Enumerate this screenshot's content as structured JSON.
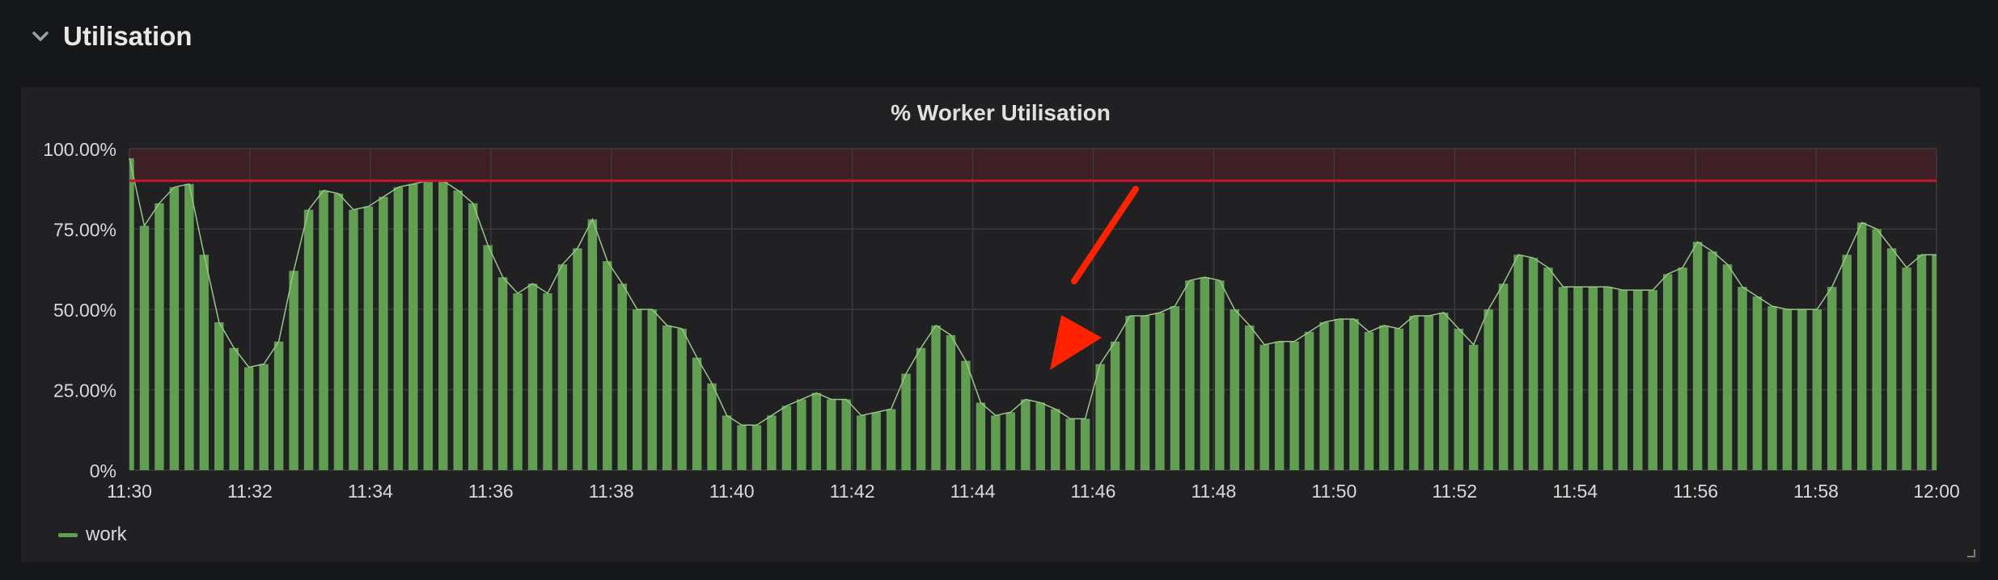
{
  "row": {
    "title": "Utilisation",
    "chevron_icon": "chevron-down-icon"
  },
  "panel": {
    "title": "% Worker Utilisation"
  },
  "colors": {
    "background": "#161719",
    "panel": "#212124",
    "bar": "#629e51",
    "bar_edge": "#9ac48a",
    "threshold_line": "#c4162a",
    "threshold_fill": "rgba(196,22,42,0.18)",
    "arrow": "#ff2200",
    "grid": "#3b3b3d",
    "tick_text": "#d8d9da"
  },
  "chart_data": {
    "type": "bar",
    "title": "% Worker Utilisation",
    "x_tick_labels": [
      "11:30",
      "11:32",
      "11:34",
      "11:36",
      "11:38",
      "11:40",
      "11:42",
      "11:44",
      "11:46",
      "11:48",
      "11:50",
      "11:52",
      "11:54",
      "11:56",
      "11:58",
      "12:00"
    ],
    "y_tick_labels": [
      "0%",
      "25.00%",
      "50.00%",
      "75.00%",
      "100.00%"
    ],
    "y_ticks": [
      0,
      25,
      50,
      75,
      100
    ],
    "ylim": [
      0,
      100
    ],
    "threshold": 90,
    "threshold_region": [
      90,
      100
    ],
    "grid": true,
    "legend_position": "bottom-left",
    "sample_interval_seconds": 10,
    "series": [
      {
        "name": "work",
        "values": [
          97,
          76,
          83,
          88,
          89,
          67,
          46,
          38,
          32,
          33,
          40,
          62,
          81,
          87,
          86,
          81,
          82,
          85,
          88,
          89,
          90,
          90,
          87,
          83,
          70,
          60,
          55,
          58,
          55,
          64,
          69,
          78,
          65,
          58,
          50,
          50,
          45,
          44,
          35,
          27,
          17,
          14,
          14,
          17,
          20,
          22,
          24,
          22,
          22,
          17,
          18,
          19,
          30,
          38,
          45,
          42,
          34,
          21,
          17,
          18,
          22,
          21,
          19,
          16,
          16,
          33,
          40,
          48,
          48,
          49,
          51,
          59,
          60,
          59,
          50,
          45,
          39,
          40,
          40,
          43,
          46,
          47,
          47,
          43,
          45,
          44,
          48,
          48,
          49,
          44,
          39,
          50,
          58,
          67,
          66,
          63,
          57,
          57,
          57,
          57,
          56,
          56,
          56,
          61,
          63,
          71,
          68,
          64,
          57,
          54,
          51,
          50,
          50,
          50,
          57,
          67,
          77,
          75,
          69,
          63,
          67,
          67
        ]
      }
    ],
    "annotation": "red arrow pointing down-left at the 11:45 dip"
  },
  "legend": {
    "items": [
      {
        "label": "work",
        "color": "#629e51"
      }
    ]
  }
}
